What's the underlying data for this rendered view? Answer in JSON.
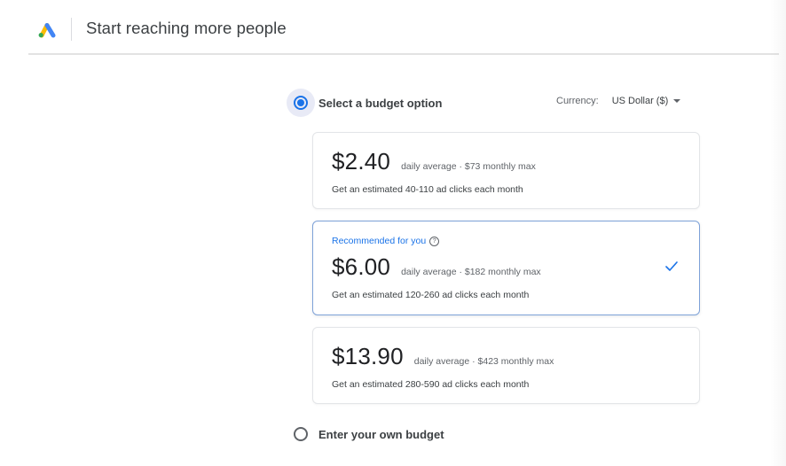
{
  "header": {
    "title": "Start reaching more people",
    "logo_icon": "google-ads-logo"
  },
  "budget_option": {
    "label": "Select a budget option",
    "selected": true
  },
  "currency": {
    "label": "Currency:",
    "value": "US Dollar ($)"
  },
  "cards": [
    {
      "price": "$2.40",
      "meta": "daily average · $73 monthly max",
      "clicks": "Get an estimated 40-110 ad clicks each month",
      "selected": false
    },
    {
      "badge": "Recommended for you",
      "help_symbol": "?",
      "price": "$6.00",
      "meta": "daily average · $182 monthly max",
      "clicks": "Get an estimated 120-260 ad clicks each month",
      "selected": true
    },
    {
      "price": "$13.90",
      "meta": "daily average · $423 monthly max",
      "clicks": "Get an estimated 280-590 ad clicks each month",
      "selected": false
    }
  ],
  "own_budget": {
    "label": "Enter your own budget",
    "selected": false
  },
  "colors": {
    "accent": "#1a73e8",
    "logo_blue": "#4285f4",
    "logo_yellow": "#fbbc04",
    "logo_green": "#34a853"
  }
}
